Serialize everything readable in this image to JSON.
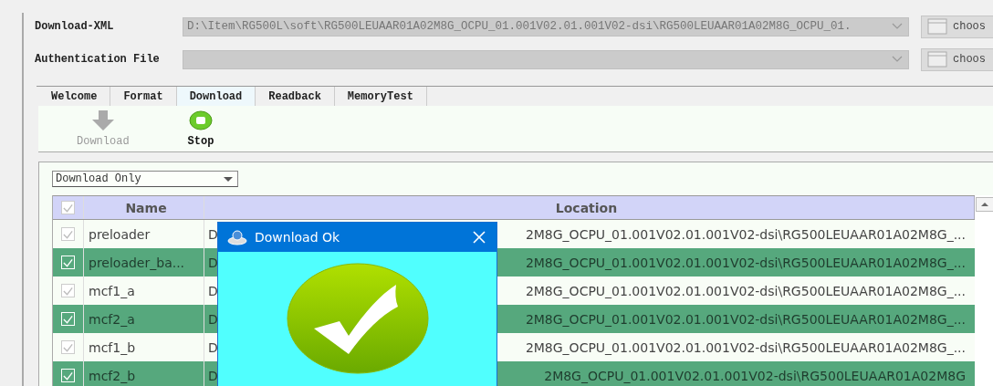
{
  "fields": [
    {
      "label": "Download-XML",
      "value": "D:\\Item\\RG500L\\soft\\RG500LEUAAR01A02M8G_OCPU_01.001V02.01.001V02-dsi\\RG500LEUAAR01A02M8G_OCPU_01.",
      "button": "choos"
    },
    {
      "label": "Authentication File",
      "button": "choos"
    }
  ],
  "tabs": [
    {
      "label": "Welcome",
      "selected": false
    },
    {
      "label": "Format",
      "selected": false
    },
    {
      "label": "Download",
      "selected": true
    },
    {
      "label": "Readback",
      "selected": false
    },
    {
      "label": "MemoryTest",
      "selected": false
    }
  ],
  "toolbar": [
    {
      "kind": "download",
      "label": "Download",
      "disabled": true
    },
    {
      "kind": "stop",
      "label": "Stop",
      "disabled": false
    }
  ],
  "mode": {
    "value": "Download Only"
  },
  "table": {
    "header_checked": true,
    "columns": [
      "Name",
      "Location"
    ],
    "rows": [
      {
        "checked": true,
        "selected": false,
        "name": "preloader",
        "location_start": "D",
        "location_end": "2M8G_OCPU_01.001V02.01.001V02-dsi\\RG500LEUAAR01A02M8G_..."
      },
      {
        "checked": true,
        "selected": true,
        "name": "preloader_ba...",
        "location_start": "D",
        "location_end": "2M8G_OCPU_01.001V02.01.001V02-dsi\\RG500LEUAAR01A02M8G_..."
      },
      {
        "checked": true,
        "selected": false,
        "name": "mcf1_a",
        "location_start": "D",
        "location_end": "2M8G_OCPU_01.001V02.01.001V02-dsi\\RG500LEUAAR01A02M8G_..."
      },
      {
        "checked": true,
        "selected": true,
        "name": "mcf2_a",
        "location_start": "D",
        "location_end": "2M8G_OCPU_01.001V02.01.001V02-dsi\\RG500LEUAAR01A02M8G_..."
      },
      {
        "checked": true,
        "selected": false,
        "name": "mcf1_b",
        "location_start": "D",
        "location_end": "2M8G_OCPU_01.001V02.01.001V02-dsi\\RG500LEUAAR01A02M8G_..."
      },
      {
        "checked": true,
        "selected": true,
        "name": "mcf2_b",
        "location_start": "D",
        "location_end": "2M8G_OCPU_01.001V02.01.001V02-dsi\\RG500LEUAAR01A02M8G"
      }
    ]
  },
  "dialog": {
    "title": "Download Ok"
  }
}
